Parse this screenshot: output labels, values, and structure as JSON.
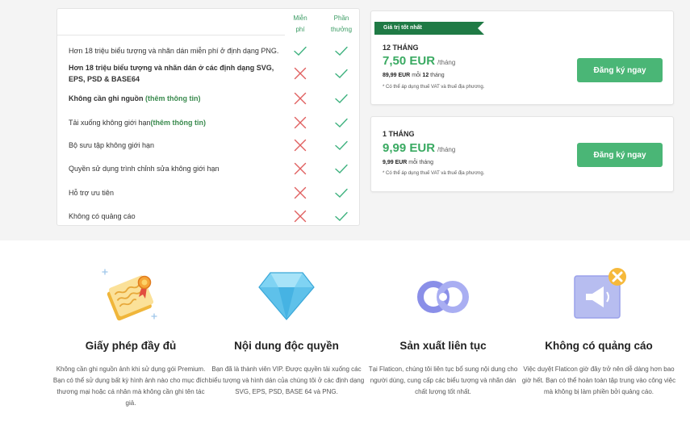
{
  "comparison": {
    "col_free": "Miễn phí",
    "col_premium": "Phần thưởng",
    "rows": [
      {
        "pre": "Hơn 18 triệu biểu tượng và nhãn dán miễn phí ở định dạng PNG.",
        "link": "",
        "bold": false,
        "free": "check",
        "premium": "check"
      },
      {
        "pre": "Hơn 18 triệu biểu tượng và nhãn dán ở các định dạng SVG, EPS, PSD & BASE64",
        "link": "",
        "bold": true,
        "free": "cross",
        "premium": "check"
      },
      {
        "pre": "Không cần ghi nguồn ",
        "link": "(thêm thông tin)",
        "bold": true,
        "free": "cross",
        "premium": "check"
      },
      {
        "pre": "Tải xuống không giới hạn",
        "link": "(thêm thông tin)",
        "bold": false,
        "free": "cross",
        "premium": "check"
      },
      {
        "pre": "Bộ sưu tập không giới hạn",
        "link": "",
        "bold": false,
        "free": "cross",
        "premium": "check"
      },
      {
        "pre": "Quyền sử dụng trình chỉnh sửa không giới hạn",
        "link": "",
        "bold": false,
        "free": "cross",
        "premium": "check"
      },
      {
        "pre": "Hỗ trợ ưu tiên",
        "link": "",
        "bold": false,
        "free": "cross",
        "premium": "check"
      },
      {
        "pre": "Không có quảng cáo",
        "link": "",
        "bold": false,
        "free": "cross",
        "premium": "check"
      }
    ]
  },
  "plans": [
    {
      "ribbon": "Giá trị tốt nhất",
      "period": "12 THÁNG",
      "price": "7,50 EUR",
      "unit": "/tháng",
      "billed_amount": "89,99 EUR",
      "billed_text_a": " mỗi ",
      "billed_num": "12",
      "billed_text_b": " tháng",
      "vat": "* Có thể áp dụng thuế VAT và thuế địa phương.",
      "cta": "Đăng ký ngay"
    },
    {
      "period": "1 THÁNG",
      "price": "9,99 EUR",
      "unit": "/tháng",
      "billed_amount": "9,99 EUR",
      "billed_text_a": " mỗi tháng",
      "vat": "* Có thể áp dụng thuế VAT và thuế địa phương.",
      "cta": "Đăng ký ngay"
    }
  ],
  "features": [
    {
      "title": "Giấy phép đầy đủ",
      "desc": "Không cần ghi nguồn ảnh khi sử dụng gói Premium. Bạn có thể sử dụng bất kỳ hình ảnh nào cho mục đích thương mại hoặc cá nhân mà không cần ghi tên tác giả.",
      "icon": "license-certificate-icon"
    },
    {
      "title": "Nội dung độc quyền",
      "desc": "Bạn đã là thành viên VIP. Được quyền tải xuống các biểu tượng và hình dán của chúng tôi ở các định dạng SVG, EPS, PSD, BASE 64 và PNG.",
      "icon": "diamond-icon"
    },
    {
      "title": "Sản xuất liên tục",
      "desc": "Tại Flaticon, chúng tôi liên tục bổ sung nội dung cho người dùng, cung cấp các biểu tượng và nhãn dán chất lượng tốt nhất.",
      "icon": "infinity-loop-icon"
    },
    {
      "title": "Không có quảng cáo",
      "desc": "Việc duyệt Flaticon giờ đây trở nên dễ dàng hơn bao giờ hết. Bạn có thể hoàn toàn tập trung vào công việc mà không bị làm phiền bởi quảng cáo.",
      "icon": "no-ads-megaphone-icon"
    }
  ],
  "colors": {
    "accent": "#3aaa62",
    "button": "#4ab676",
    "ribbon": "#1f7a45",
    "cross": "#e06060",
    "check": "#3fb27f"
  }
}
